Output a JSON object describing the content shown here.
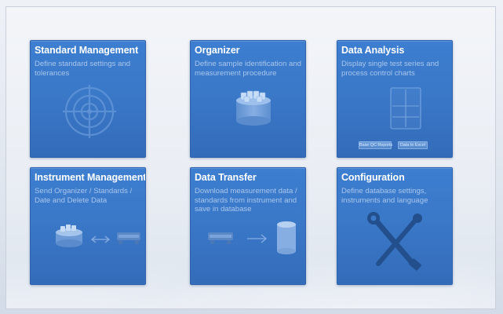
{
  "tiles": [
    {
      "title": "Standard Management",
      "description": "Define standard settings and tolerances",
      "icon": "target-icon"
    },
    {
      "title": "Organizer",
      "description": "Define sample identification and measurement procedure",
      "icon": "sample-tray-icon"
    },
    {
      "title": "Data Analysis",
      "description": "Display single test series and process control charts",
      "icon": "chart-document-icon",
      "buttons": [
        "Base QC Reports",
        "Data to Excel"
      ]
    },
    {
      "title": "Instrument Management",
      "description": "Send Organizer / Standards / Date and Delete Data",
      "icon": "instrument-sync-icon"
    },
    {
      "title": "Data Transfer",
      "description": "Download measurement data / standards from instrument and save in database",
      "icon": "download-database-icon"
    },
    {
      "title": "Configuration",
      "description": "Define database settings, instruments and language",
      "icon": "tools-icon"
    }
  ],
  "colors": {
    "tile": "#3a78c8",
    "tile_border": "#2f63ad",
    "title": "#ffffff",
    "description": "#a9c6ec"
  }
}
